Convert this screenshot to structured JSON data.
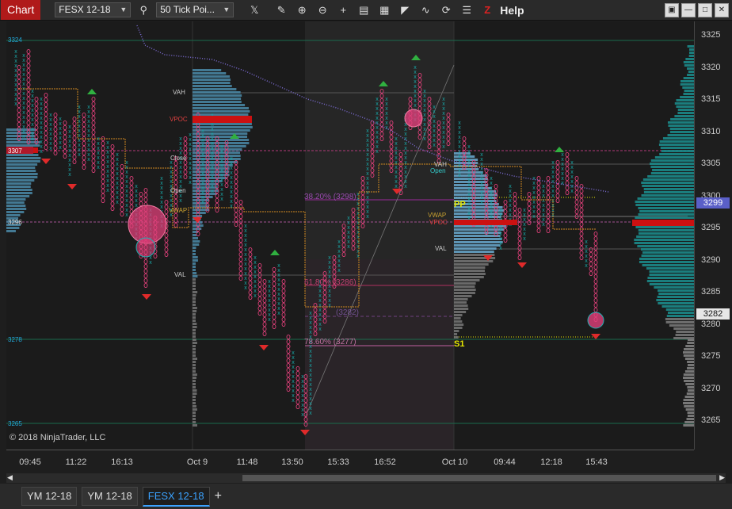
{
  "toolbar": {
    "chart_tab": "Chart",
    "instrument": "FESX 12-18",
    "bar_type": "50 Tick Poi...",
    "help": "Help",
    "icons": [
      "search-icon",
      "data-series-icon",
      "pencil-icon",
      "zoom-in-icon",
      "zoom-out-icon",
      "crosshair-icon",
      "data-box-icon",
      "strategy-icon",
      "drawing-tools-icon",
      "indicator-icon",
      "refresh-icon",
      "properties-icon",
      "z-order-icon"
    ]
  },
  "window_buttons": [
    "minimize",
    "restore",
    "close"
  ],
  "price_axis": {
    "labels": [
      "3325",
      "3320",
      "3315",
      "3310",
      "3305",
      "3300",
      "3295",
      "3290",
      "3285",
      "3280",
      "3275",
      "3270",
      "3265"
    ],
    "current_price": "3299",
    "current_price_color": "#5a5fc8",
    "last_price": "3282",
    "last_price_color": "#e6e6e6"
  },
  "time_axis": {
    "labels": [
      "09:45",
      "11:22",
      "16:13",
      "Oct 9",
      "11:48",
      "13:50",
      "15:33",
      "16:52",
      "Oct 10",
      "09:44",
      "12:18",
      "15:43"
    ]
  },
  "chart_labels": {
    "left_prices": [
      "3324",
      "3307",
      "3296",
      "3278",
      "3265"
    ],
    "profile_labels": [
      "VAH",
      "VPOC",
      "Close",
      "Open",
      "VWAP",
      "VAL",
      "VAH",
      "Open",
      "VWAP",
      "VPOC",
      "VAL"
    ],
    "fib_levels": [
      "38.20% (3298)",
      "61.80% (3286)",
      "(3282)",
      "78.60% (3277)"
    ],
    "pivots": [
      "PP",
      "S1"
    ],
    "copyright": "© 2018 NinjaTrader, LLC"
  },
  "colors": {
    "x_color": "#19a6a6",
    "o_color": "#e0407a",
    "vpoc_color": "#cc1111",
    "profile_color": "#5aa0c8",
    "accent": "#b01a1a"
  },
  "tabs": [
    "YM 12-18",
    "YM 12-18",
    "FESX 12-18"
  ],
  "active_tab": "FESX 12-18"
}
